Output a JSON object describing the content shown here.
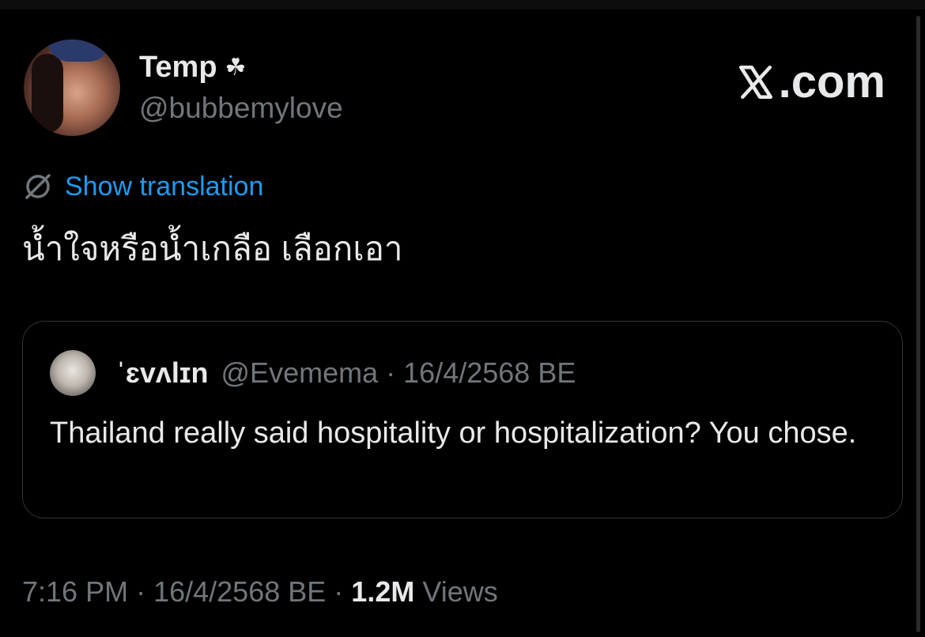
{
  "author": {
    "name": "Temp",
    "badge": "☘",
    "handle": "@bubbemylove"
  },
  "brand": {
    "text": ".com"
  },
  "translation": {
    "label": "Show translation"
  },
  "tweet": {
    "text": "น้ำใจหรือน้ำเกลือ เลือกเอา"
  },
  "quote": {
    "name": "ˈɛvʌlɪn",
    "handle": "@Evemema",
    "date": "16/4/2568 BE",
    "text": "Thailand really said hospitality or hospitalization? You chose."
  },
  "footer": {
    "time": "7:16 PM",
    "date": "16/4/2568 BE",
    "views_count": "1.2M",
    "views_label": "Views"
  },
  "colors": {
    "background": "#000000",
    "text": "#e7e9ea",
    "muted": "#71767b",
    "link": "#1d9bf0",
    "border": "#2f3336"
  }
}
